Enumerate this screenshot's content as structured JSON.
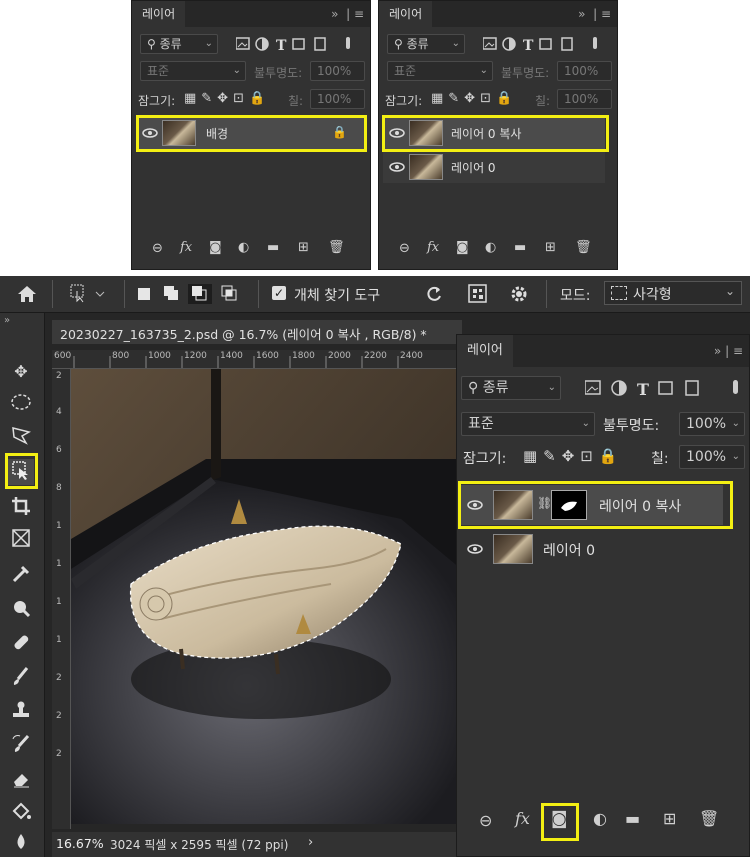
{
  "panel_a": {
    "tab": "레이어",
    "collapse": "»",
    "menu": "≡",
    "filter_label": "종류",
    "blend_mode": "표준",
    "opacity_label": "불투명도:",
    "opacity_value": "100%",
    "lock_label": "잠그기:",
    "fill_label": "칠:",
    "fill_value": "100%",
    "layers": [
      {
        "name": "배경",
        "selected": true
      }
    ]
  },
  "panel_b": {
    "tab": "레이어",
    "collapse": "»",
    "menu": "≡",
    "filter_label": "종류",
    "blend_mode": "표준",
    "opacity_label": "불투명도:",
    "opacity_value": "100%",
    "lock_label": "잠그기:",
    "fill_label": "칠:",
    "fill_value": "100%",
    "layers": [
      {
        "name": "레이어 0 복사",
        "selected": true
      },
      {
        "name": "레이어 0",
        "selected": false
      }
    ]
  },
  "options_bar": {
    "object_finder_label": "개체 찾기 도구",
    "mode_label": "모드:",
    "mode_value": "사각형"
  },
  "document": {
    "tab_title": "20230227_163735_2.psd @ 16.7% (레이어 0 복사 , RGB/8) *",
    "ruler_ticks": [
      "600",
      "800",
      "1000",
      "1200",
      "1400",
      "1600",
      "1800",
      "2000",
      "2200",
      "2400"
    ],
    "ruler_v_ticks": [
      "2",
      "4",
      "6",
      "8",
      "1",
      "1",
      "1",
      "1",
      "2",
      "2",
      "2"
    ],
    "zoom": "16.67%",
    "doc_info": "3024 픽셀 x 2595 픽셀 (72 ppi)",
    "doc_info_arrow": "›"
  },
  "panel_c": {
    "tab": "레이어",
    "collapse": "»",
    "menu": "≡",
    "filter_label": "종류",
    "blend_mode": "표준",
    "opacity_label": "불투명도:",
    "opacity_value": "100%",
    "lock_label": "잠그기:",
    "fill_label": "칠:",
    "fill_value": "100%",
    "layers": [
      {
        "name": "레이어 0 복사",
        "selected": true
      },
      {
        "name": "레이어 0",
        "selected": false
      }
    ]
  },
  "toolbar": {
    "collapse": "»",
    "tools": [
      "move-tool",
      "ellipse-marquee-tool",
      "lasso-tool",
      "object-selection-tool",
      "crop-tool",
      "frame-tool",
      "eyedropper-tool",
      "spot-healing-tool",
      "healing-brush-tool",
      "brush-tool",
      "clone-stamp-tool",
      "history-brush-tool",
      "eraser-tool",
      "paint-bucket-tool",
      "blur-tool"
    ]
  },
  "colors": {
    "panel_bg": "#323232",
    "app_bg": "#262626",
    "highlight": "#f3ef13"
  }
}
